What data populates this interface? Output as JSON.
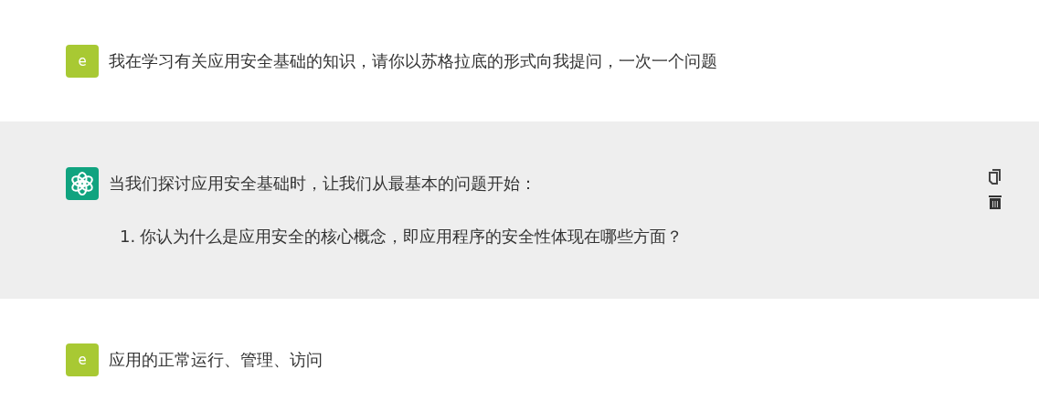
{
  "messages": [
    {
      "kind": "user",
      "avatar": "e",
      "text": "我在学习有关应用安全基础的知识，请你以苏格拉底的形式向我提问，一次一个问题"
    },
    {
      "kind": "assistant",
      "text": "当我们探讨应用安全基础时，让我们从最基本的问题开始：",
      "list": [
        {
          "number": "1.",
          "text": "你认为什么是应用安全的核心概念，即应用程序的安全性体现在哪些方面？"
        }
      ]
    },
    {
      "kind": "user",
      "avatar": "e",
      "text": "应用的正常运行、管理、访问"
    }
  ]
}
